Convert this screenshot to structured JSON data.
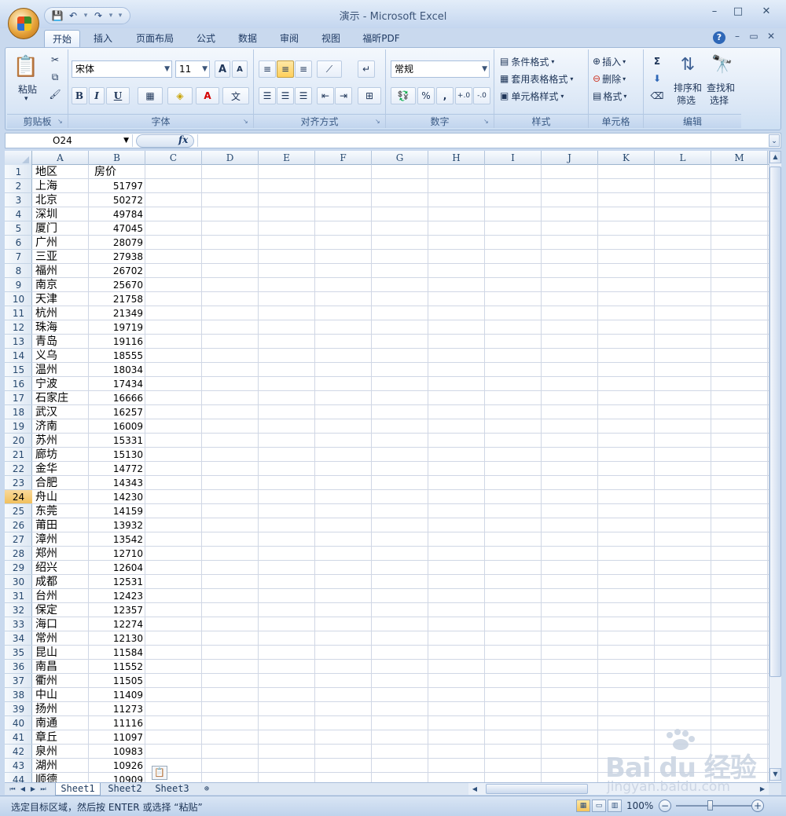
{
  "window": {
    "title": "演示 - Microsoft Excel",
    "controls": {
      "minimize": "–",
      "maximize": "□",
      "close": "✕"
    },
    "doc_controls": {
      "minimize": "–",
      "restore": "▭",
      "close": "✕"
    }
  },
  "quick_access": {
    "save": "💾",
    "undo": "↶",
    "redo": "↷",
    "more": "▾"
  },
  "tabs": [
    "开始",
    "插入",
    "页面布局",
    "公式",
    "数据",
    "审阅",
    "视图",
    "福昕PDF"
  ],
  "active_tab": "开始",
  "ribbon": {
    "clipboard": {
      "label": "剪贴板",
      "paste": "粘贴"
    },
    "font": {
      "label": "字体",
      "font_name": "宋体",
      "font_size": "11",
      "bold": "B",
      "italic": "I",
      "underline": "U",
      "grow": "A",
      "shrink": "A",
      "font_color": "A",
      "phonetic": "文"
    },
    "alignment": {
      "label": "对齐方式"
    },
    "number": {
      "label": "数字",
      "format": "常规",
      "percent": "%",
      "comma": ",",
      "inc_decimal": "+.0",
      "dec_decimal": "-.0"
    },
    "styles": {
      "label": "样式",
      "conditional": "条件格式",
      "table_format": "套用表格格式",
      "cell_style": "单元格样式"
    },
    "cells": {
      "label": "单元格",
      "insert": "插入",
      "delete": "删除",
      "format": "格式"
    },
    "editing": {
      "label": "编辑",
      "sort_filter_1": "排序和",
      "sort_filter_2": "筛选",
      "find_select_1": "查找和",
      "find_select_2": "选择",
      "sum": "Σ"
    }
  },
  "formula_bar": {
    "name_box": "O24",
    "fx": "fx",
    "formula": ""
  },
  "columns": [
    "A",
    "B",
    "C",
    "D",
    "E",
    "F",
    "G",
    "H",
    "I",
    "J",
    "K",
    "L",
    "M"
  ],
  "active_row": 24,
  "header_row": {
    "a": "地区",
    "b": "房价"
  },
  "rows": [
    {
      "a": "上海",
      "b": "51797"
    },
    {
      "a": "北京",
      "b": "50272"
    },
    {
      "a": "深圳",
      "b": "49784"
    },
    {
      "a": "厦门",
      "b": "47045"
    },
    {
      "a": "广州",
      "b": "28079"
    },
    {
      "a": "三亚",
      "b": "27938"
    },
    {
      "a": "福州",
      "b": "26702"
    },
    {
      "a": "南京",
      "b": "25670"
    },
    {
      "a": "天津",
      "b": "21758"
    },
    {
      "a": "杭州",
      "b": "21349"
    },
    {
      "a": "珠海",
      "b": "19719"
    },
    {
      "a": "青岛",
      "b": "19116"
    },
    {
      "a": "义乌",
      "b": "18555"
    },
    {
      "a": "温州",
      "b": "18034"
    },
    {
      "a": "宁波",
      "b": "17434"
    },
    {
      "a": "石家庄",
      "b": "16666"
    },
    {
      "a": "武汉",
      "b": "16257"
    },
    {
      "a": "济南",
      "b": "16009"
    },
    {
      "a": "苏州",
      "b": "15331"
    },
    {
      "a": "廊坊",
      "b": "15130"
    },
    {
      "a": "金华",
      "b": "14772"
    },
    {
      "a": "合肥",
      "b": "14343"
    },
    {
      "a": "舟山",
      "b": "14230"
    },
    {
      "a": "东莞",
      "b": "14159"
    },
    {
      "a": "莆田",
      "b": "13932"
    },
    {
      "a": "漳州",
      "b": "13542"
    },
    {
      "a": "郑州",
      "b": "12710"
    },
    {
      "a": "绍兴",
      "b": "12604"
    },
    {
      "a": "成都",
      "b": "12531"
    },
    {
      "a": "台州",
      "b": "12423"
    },
    {
      "a": "保定",
      "b": "12357"
    },
    {
      "a": "海口",
      "b": "12274"
    },
    {
      "a": "常州",
      "b": "12130"
    },
    {
      "a": "昆山",
      "b": "11584"
    },
    {
      "a": "南昌",
      "b": "11552"
    },
    {
      "a": "衢州",
      "b": "11505"
    },
    {
      "a": "中山",
      "b": "11409"
    },
    {
      "a": "扬州",
      "b": "11273"
    },
    {
      "a": "南通",
      "b": "11116"
    },
    {
      "a": "章丘",
      "b": "11097"
    },
    {
      "a": "泉州",
      "b": "10983"
    },
    {
      "a": "湖州",
      "b": "10926"
    },
    {
      "a": "顺德",
      "b": "10909"
    }
  ],
  "sheets": [
    "Sheet1",
    "Sheet2",
    "Sheet3"
  ],
  "active_sheet": "Sheet1",
  "status": {
    "message": "选定目标区域，然后按 ENTER 或选择 “粘贴”",
    "zoom": "100%"
  },
  "watermark": {
    "brand": "Bai du 经验",
    "url": "jingyan.baidu.com"
  },
  "colors": {
    "accent": "#f1c05c",
    "ribbon": "#dbe7f6",
    "grid_line": "#d0d7e5"
  }
}
